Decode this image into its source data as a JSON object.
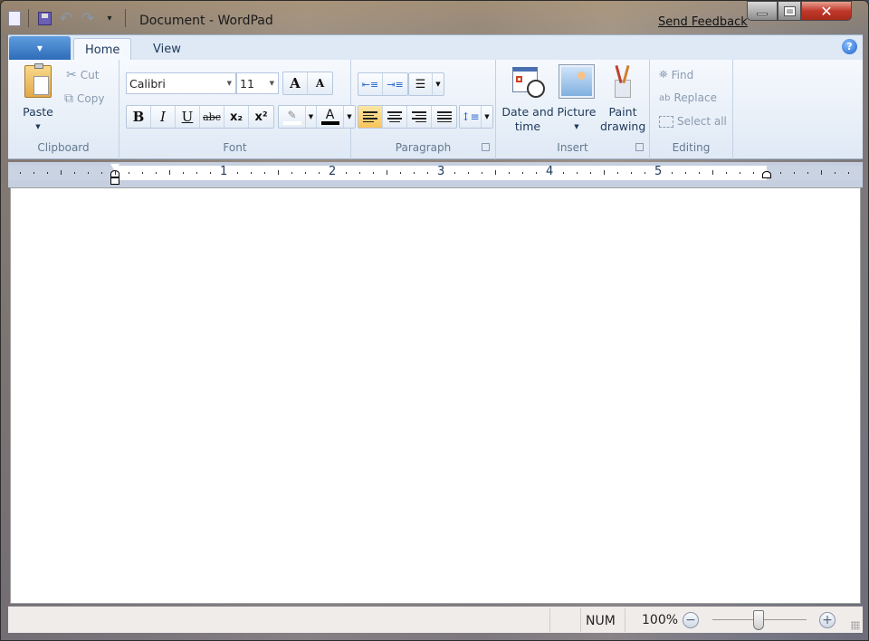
{
  "window": {
    "title": "Document - WordPad",
    "send_feedback": "Send Feedback",
    "caption": {
      "minimize": "—",
      "maximize": "□",
      "close": "✕"
    }
  },
  "quick_access": [
    {
      "name": "wordpad-app-icon",
      "glyph": "📄"
    },
    {
      "name": "save-icon",
      "glyph": "💾"
    },
    {
      "name": "undo-icon",
      "glyph": "↶"
    },
    {
      "name": "redo-icon",
      "glyph": "↷"
    },
    {
      "name": "customize-qat-icon",
      "glyph": "▾"
    }
  ],
  "ribbon": {
    "tabs": [
      {
        "label": "Home",
        "active": true
      },
      {
        "label": "View",
        "active": false
      }
    ],
    "help": "?",
    "clipboard": {
      "label": "Clipboard",
      "paste": "Paste",
      "cut": "Cut",
      "copy": "Copy"
    },
    "font": {
      "label": "Font",
      "family": "Calibri",
      "size": "11",
      "grow": "A",
      "shrink": "A",
      "bold": "B",
      "italic": "I",
      "underline": "U",
      "strikethrough": "abc",
      "subscript": "x₂",
      "superscript": "x²",
      "font_color": "A",
      "highlight_color": "#ffffff",
      "text_color": "#000000"
    },
    "paragraph": {
      "label": "Paragraph",
      "active_alignment": "left"
    },
    "insert": {
      "label": "Insert",
      "date_time": "Date and time",
      "picture": "Picture",
      "paint": "Paint drawing"
    },
    "editing": {
      "label": "Editing",
      "find": "Find",
      "replace": "Replace",
      "select_all": "Select all"
    }
  },
  "ruler": {
    "numbers": [
      "1",
      "2",
      "3",
      "4",
      "5"
    ]
  },
  "status": {
    "num": "NUM",
    "zoom": "100%",
    "zoom_out": "−",
    "zoom_in": "+"
  }
}
